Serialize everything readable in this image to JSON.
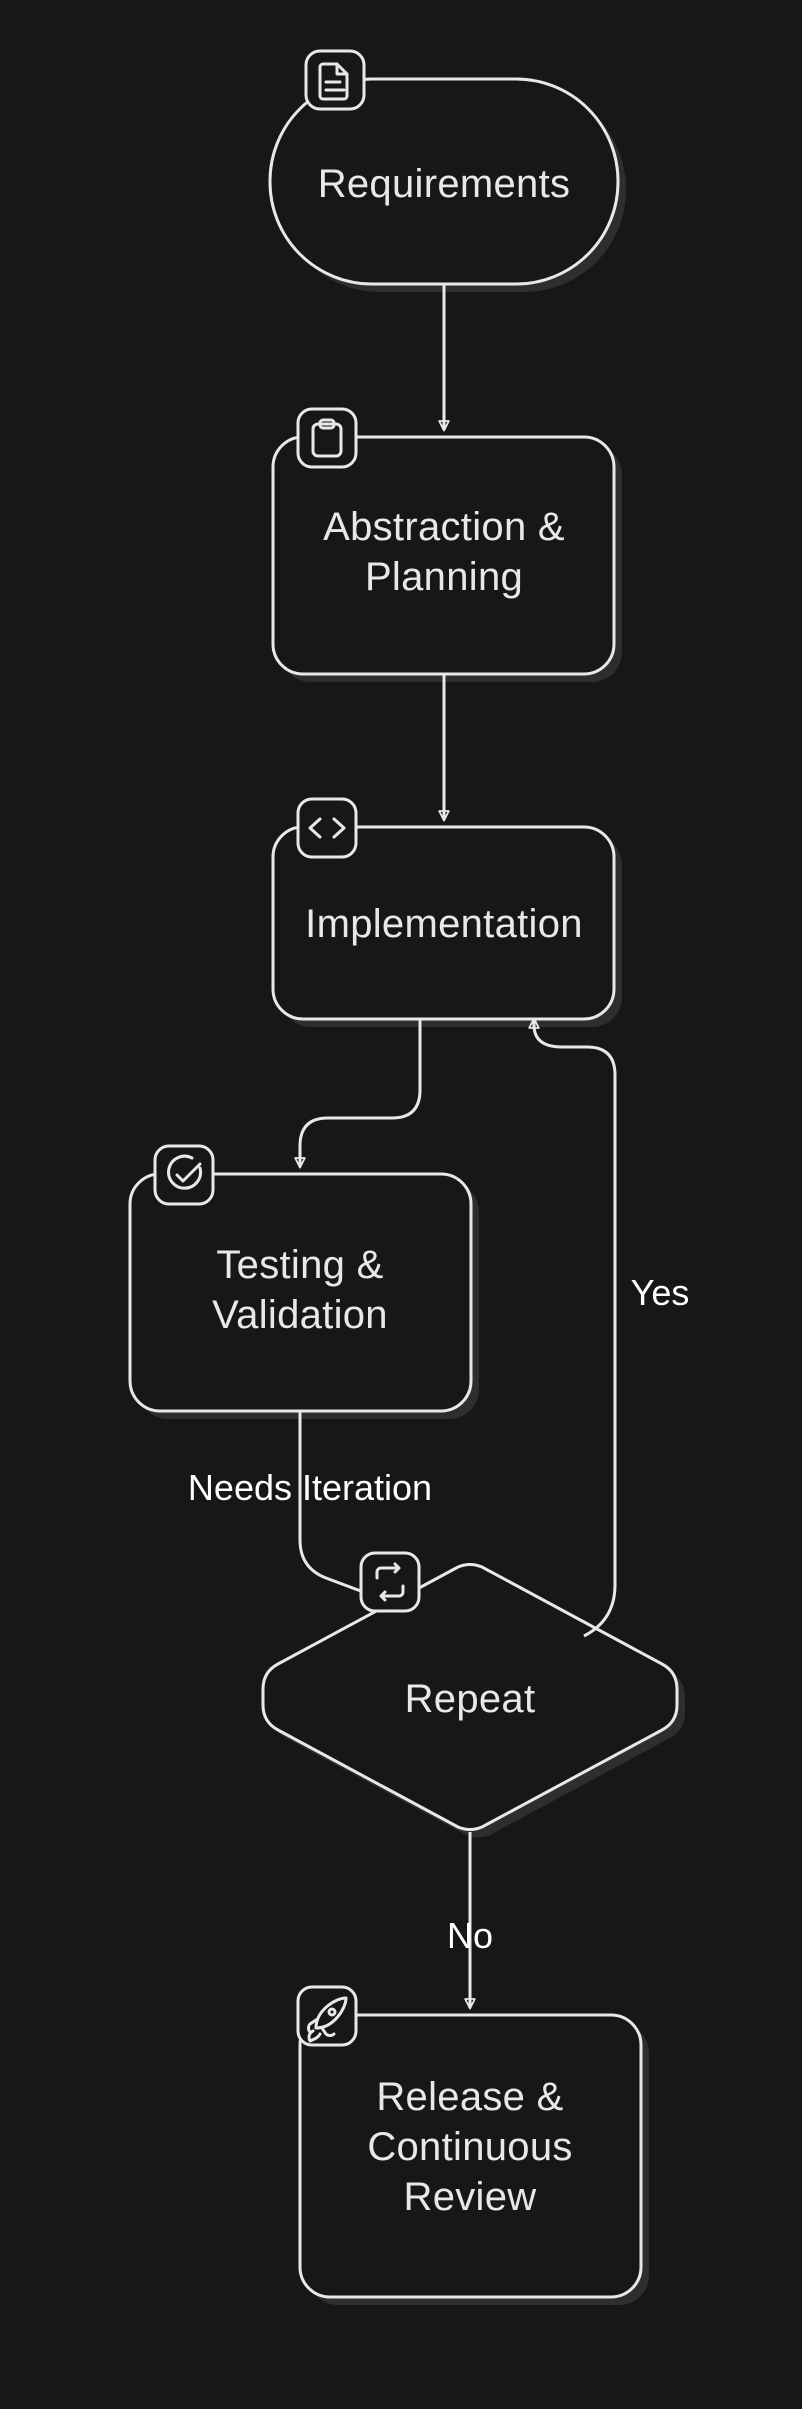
{
  "nodes": {
    "requirements": {
      "label": "Requirements"
    },
    "planning": {
      "label_l1": "Abstraction &",
      "label_l2": "Planning"
    },
    "impl": {
      "label": "Implementation"
    },
    "testing": {
      "label_l1": "Testing &",
      "label_l2": "Validation"
    },
    "repeat": {
      "label": "Repeat"
    },
    "release": {
      "label_l1": "Release &",
      "label_l2": "Continuous",
      "label_l3": "Review"
    }
  },
  "edges": {
    "needs_iteration": "Needs Iteration",
    "yes": "Yes",
    "no": "No"
  }
}
